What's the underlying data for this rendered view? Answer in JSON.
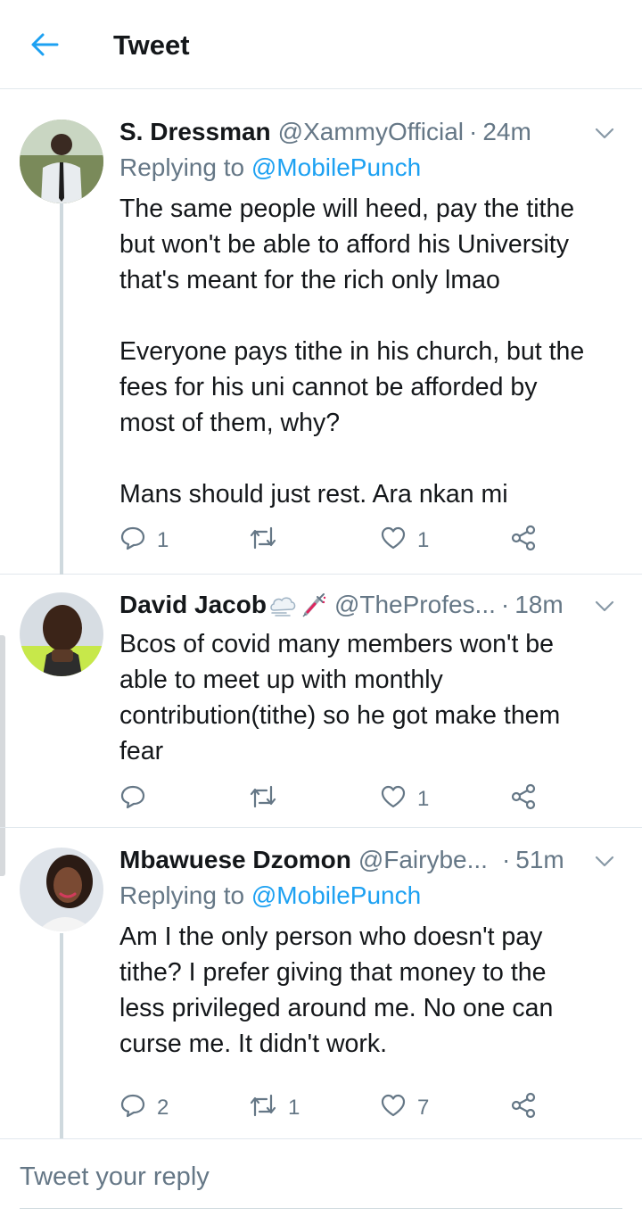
{
  "header": {
    "title": "Tweet"
  },
  "tweets": [
    {
      "name": "S. Dressman",
      "handle": "@XammyOfficial",
      "time": "24m",
      "replying_prefix": "Replying to",
      "replying_to": "@MobilePunch",
      "text": "The same people will heed, pay the tithe\nbut won't be able to afford his University\nthat's meant for the rich only lmao\n\nEveryone pays tithe in his church, but the\nfees for his uni cannot be afforded by\nmost of them, why?\n\nMans should just rest. Ara nkan mi",
      "replies": "1",
      "retweets": "",
      "likes": "1"
    },
    {
      "name": "David Jacob",
      "handle": "@TheProfes...",
      "time": "18m",
      "text": "Bcos of covid many members won't be\nable to meet up with monthly\ncontribution(tithe) so he got make them\nfear",
      "replies": "",
      "retweets": "",
      "likes": "1"
    },
    {
      "name": "Mbawuese Dzomon",
      "handle": "@Fairybe...",
      "time": "51m",
      "replying_prefix": "Replying to",
      "replying_to": "@MobilePunch",
      "text": "Am I the only person who doesn't pay\ntithe? I prefer giving that money to the\nless privileged around me. No one can\ncurse me. It didn't work.",
      "replies": "2",
      "retweets": "1",
      "likes": "7"
    }
  ],
  "reply_box": {
    "placeholder": "Tweet your reply"
  },
  "colors": {
    "accent": "#1da1f2",
    "muted": "#657786",
    "divider": "#e1e8ed"
  }
}
